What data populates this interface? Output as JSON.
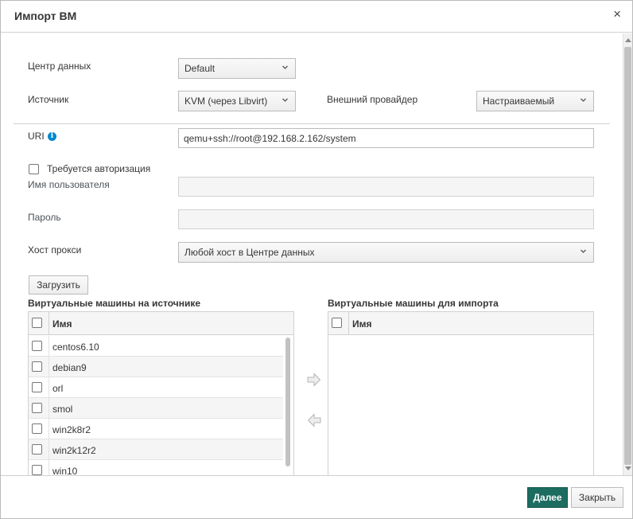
{
  "dialog": {
    "title": "Импорт ВМ",
    "close_label": "×"
  },
  "form": {
    "datacenter": {
      "label": "Центр данных",
      "value": "Default"
    },
    "source": {
      "label": "Источник",
      "value": "KVM (через Libvirt)"
    },
    "external_provider": {
      "label": "Внешний провайдер",
      "value": "Настраиваемый"
    },
    "uri": {
      "label": "URI",
      "value": "qemu+ssh://root@192.168.2.162/system"
    },
    "auth_required": {
      "label": "Требуется авторизация",
      "checked": false
    },
    "username": {
      "label": "Имя пользователя",
      "value": ""
    },
    "password": {
      "label": "Пароль",
      "value": ""
    },
    "proxy_host": {
      "label": "Хост прокси",
      "value": "Любой хост в Центре данных"
    },
    "load_button": "Загрузить"
  },
  "source_vms": {
    "title": "Виртуальные машины на источнике",
    "column": "Имя",
    "rows": [
      "centos6.10",
      "debian9",
      "orl",
      "smol",
      "win2k8r2",
      "win2k12r2",
      "win10"
    ]
  },
  "import_vms": {
    "title": "Виртуальные машины для импорта",
    "column": "Имя",
    "rows": []
  },
  "footer": {
    "next_button": "Далее",
    "close_button": "Закрыть"
  },
  "colors": {
    "primary": "#1c6c60",
    "info": "#0088ce"
  },
  "icons": [
    "info-icon",
    "chevron-down-icon",
    "arrow-right-icon",
    "arrow-left-icon",
    "close-icon"
  ]
}
